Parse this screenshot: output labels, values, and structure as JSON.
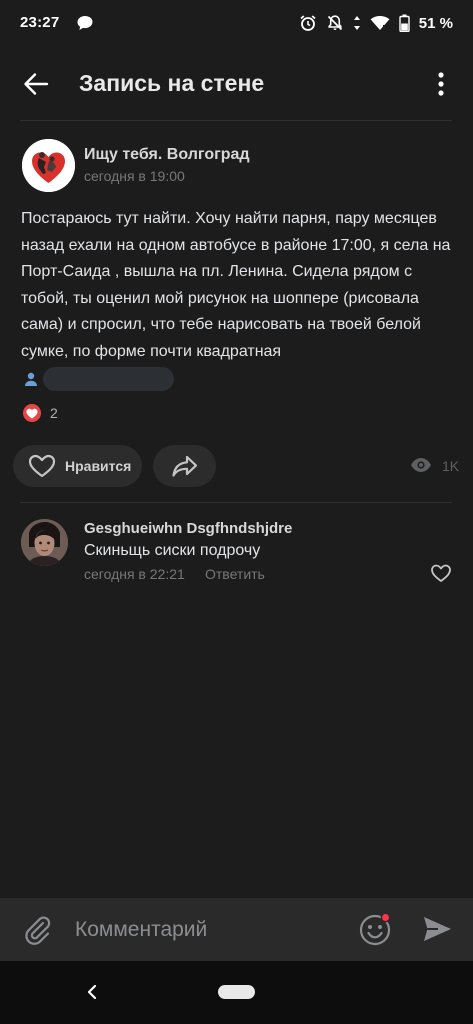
{
  "status_bar": {
    "time": "23:27",
    "battery_percent": "51 %",
    "icons": [
      "chat-bubble-icon",
      "alarm-icon",
      "bell-off-icon",
      "data-arrows-icon",
      "wifi-icon",
      "battery-icon"
    ]
  },
  "app_bar": {
    "title": "Запись на стене",
    "back_icon": "arrow-left-icon",
    "menu_icon": "more-vertical-icon"
  },
  "post": {
    "author": "Ищу тебя. Волгоград",
    "time": "сегодня в 19:00",
    "text": "Постараюсь тут найти. Хочу найти парня, пару месяцев назад ехали на одном автобусе в районе 17:00, я села на Порт-Саида , вышла на пл. Ленина. Сидела рядом с тобой, ты оценил мой рисунок на шоппере (рисовала сама) и спросил, что тебе нарисовать на твоей белой сумке, по форме почти квадратная",
    "reactions_count": "2",
    "like_label": "Нравится",
    "views": "1K"
  },
  "comment": {
    "author": "Gesghueiwhn Dsgfhndshjdre",
    "text": "Скиньщь сиски подрочу",
    "time": "сегодня в 22:21",
    "reply_label": "Ответить"
  },
  "composer": {
    "placeholder": "Комментарий"
  },
  "colors": {
    "background": "#1c1c1c",
    "reaction_red": "#e64646",
    "emoji_dot": "#ff3347",
    "button_bg": "#2c2c2c"
  }
}
